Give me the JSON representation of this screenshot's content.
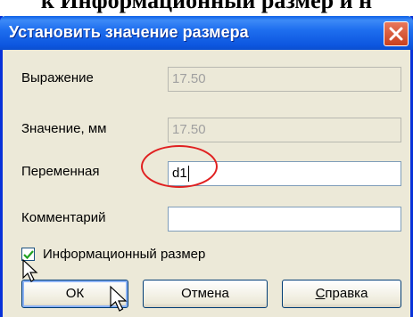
{
  "page": {
    "heading": "к Информационный размер и н"
  },
  "dialog": {
    "title": "Установить значение размера",
    "fields": {
      "expression": {
        "label": "Выражение",
        "value": "17.50"
      },
      "value_mm": {
        "label": "Значение, мм",
        "value": "17.50"
      },
      "variable": {
        "label": "Переменная",
        "value": "d1"
      },
      "comment": {
        "label": "Комментарий",
        "value": ""
      }
    },
    "checkbox": {
      "label": "Информационный размер",
      "checked": true
    },
    "buttons": {
      "ok": "ОК",
      "cancel": "Отмена",
      "help_prefix": "",
      "help_underlined": "С",
      "help_rest": "правка"
    }
  },
  "colors": {
    "titlebar": "#0a5fe6",
    "dialog_bg": "#ece9d8",
    "highlight": "#e02020"
  }
}
